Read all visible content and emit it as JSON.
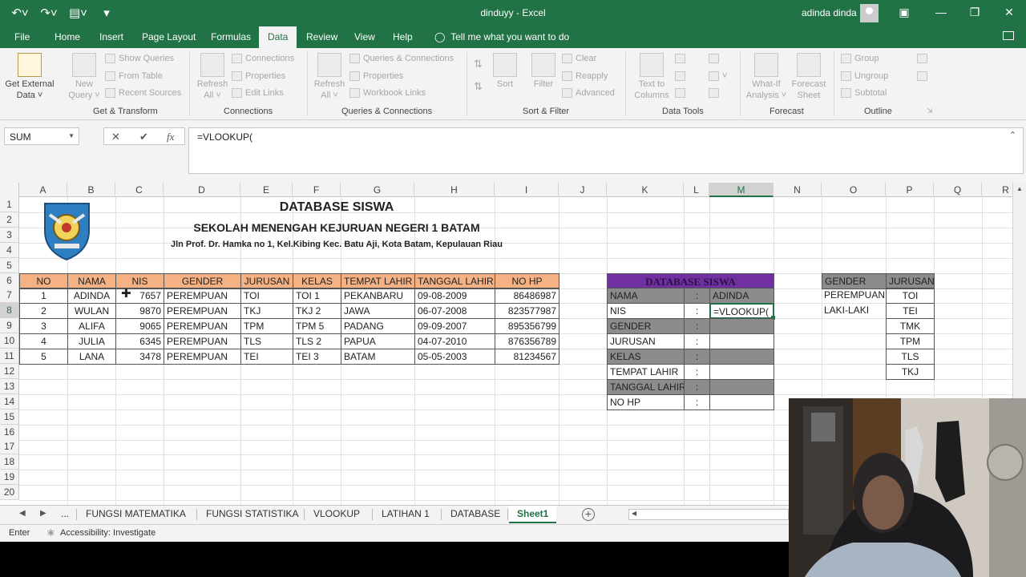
{
  "window": {
    "title": "dinduyy  -  Excel",
    "user": "adinda dinda"
  },
  "tabs": [
    {
      "label": "File"
    },
    {
      "label": "Home"
    },
    {
      "label": "Insert"
    },
    {
      "label": "Page Layout"
    },
    {
      "label": "Formulas"
    },
    {
      "label": "Data"
    },
    {
      "label": "Review"
    },
    {
      "label": "View"
    },
    {
      "label": "Help"
    }
  ],
  "tellme": "Tell me what you want to do",
  "ribbon": {
    "get_external": [
      "Get External",
      "Data ˅"
    ],
    "new_query": [
      "New",
      "Query ˅"
    ],
    "show_queries": "Show Queries",
    "from_table": "From Table",
    "recent_sources": "Recent Sources",
    "get_transform": "Get & Transform",
    "refresh_all": [
      "Refresh",
      "All ˅"
    ],
    "connections": "Connections",
    "properties": "Properties",
    "edit_links": "Edit Links",
    "connections_group": "Connections",
    "refresh_all2": [
      "Refresh",
      "All ˅"
    ],
    "queries_connections": "Queries & Connections",
    "properties2": "Properties",
    "workbook_links": "Workbook Links",
    "queries_group": "Queries & Connections",
    "sort": "Sort",
    "filter": "Filter",
    "clear": "Clear",
    "reapply": "Reapply",
    "advanced": "Advanced",
    "sort_filter_group": "Sort & Filter",
    "text_to_columns": [
      "Text to",
      "Columns"
    ],
    "data_tools_group": "Data Tools",
    "what_if": [
      "What-If",
      "Analysis ˅"
    ],
    "forecast_sheet": [
      "Forecast",
      "Sheet"
    ],
    "forecast_group": "Forecast",
    "group": "Group",
    "ungroup": "Ungroup",
    "subtotal": "Subtotal",
    "outline_group": "Outline"
  },
  "formula_bar": {
    "name_box": "SUM",
    "cancel": "✕",
    "enter": "✔",
    "fx": "fx",
    "formula": "=VLOOKUP("
  },
  "columns": [
    "A",
    "B",
    "C",
    "D",
    "E",
    "F",
    "G",
    "H",
    "I",
    "J",
    "K",
    "L",
    "M",
    "N",
    "O",
    "P",
    "Q",
    "R"
  ],
  "rows": [
    "1",
    "2",
    "3",
    "4",
    "5",
    "6",
    "7",
    "8",
    "9",
    "10",
    "11",
    "12",
    "13",
    "14",
    "15",
    "16",
    "17",
    "18",
    "19",
    "20"
  ],
  "sheet": {
    "title": "DATABASE SISWA",
    "school": "SEKOLAH MENENGAH KEJURUAN NEGERI 1 BATAM",
    "address": "Jln Prof. Dr. Hamka no 1, Kel.Kibing Kec. Batu Aji, Kota Batam, Kepulauan Riau",
    "table_headers": [
      "NO",
      "NAMA",
      "NIS",
      "GENDER",
      "JURUSAN",
      "KELAS",
      "TEMPAT LAHIR",
      "TANGGAL LAHIR",
      "NO HP"
    ],
    "table_rows": [
      [
        "1",
        "ADINDA",
        "7657",
        "PEREMPUAN",
        "TOI",
        "TOI 1",
        "PEKANBARU",
        "09-08-2009",
        "86486987"
      ],
      [
        "2",
        "WULAN",
        "9870",
        "PEREMPUAN",
        "TKJ",
        "TKJ 2",
        "JAWA",
        "06-07-2008",
        "823577987"
      ],
      [
        "3",
        "ALIFA",
        "9065",
        "PEREMPUAN",
        "TPM",
        "TPM 5",
        "PADANG",
        "09-09-2007",
        "895356799"
      ],
      [
        "4",
        "JULIA",
        "6345",
        "PEREMPUAN",
        "TLS",
        "TLS 2",
        "PAPUA",
        "04-07-2010",
        "876356789"
      ],
      [
        "5",
        "LANA",
        "3478",
        "PEREMPUAN",
        "TEI",
        "TEI 3",
        "BATAM",
        "05-05-2003",
        "81234567"
      ]
    ],
    "lookup_title": "DATABASE SISWA",
    "lookup_labels": [
      "NAMA",
      "NIS",
      "GENDER",
      "JURUSAN",
      "KELAS",
      "TEMPAT LAHIR",
      "TANGGAL LAHIR",
      "NO HP"
    ],
    "colon": ":",
    "lookup_values": [
      "ADINDA",
      "=VLOOKUP(",
      "",
      "",
      "",
      "",
      "",
      ""
    ],
    "ref_headers": [
      "GENDER",
      "JURUSAN"
    ],
    "ref_gender": [
      "PEREMPUAN",
      "LAKI-LAKI"
    ],
    "ref_jurusan": [
      "TOI",
      "TEI",
      "TMK",
      "TPM",
      "TLS",
      "TKJ"
    ]
  },
  "sheet_tabs": [
    "...",
    "FUNGSI MATEMATIKA",
    "FUNGSI STATISTIKA",
    "VLOOKUP",
    "LATIHAN 1",
    "DATABASE",
    "Sheet1"
  ],
  "status": {
    "mode": "Enter",
    "accessibility": "Accessibility: Investigate"
  },
  "colors": {
    "excel_green": "#217346",
    "header_orange": "#f4b183",
    "purple": "#7030a0",
    "grey_fill": "#8c8c8c"
  }
}
